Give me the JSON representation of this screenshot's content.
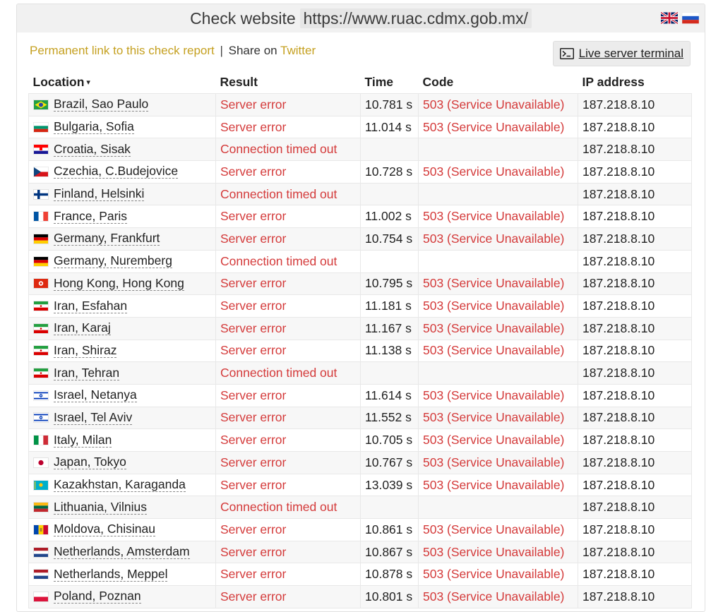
{
  "header": {
    "title_label": "Check website",
    "url": "https://www.ruac.cdmx.gob.mx/",
    "languages": [
      {
        "name": "English",
        "icon": "uk-flag-icon"
      },
      {
        "name": "Russian",
        "icon": "russia-flag-icon"
      }
    ]
  },
  "links": {
    "permanent": "Permanent link to this check report",
    "separator": "|",
    "share_prefix": "Share on",
    "twitter": "Twitter"
  },
  "terminal_button": {
    "icon": "terminal-icon",
    "label": "Live server terminal"
  },
  "table": {
    "columns": {
      "location": "Location",
      "sort_indicator": "▾",
      "result": "Result",
      "time": "Time",
      "code": "Code",
      "ip": "IP address"
    },
    "rows": [
      {
        "country": "br",
        "location": "Brazil, Sao Paulo",
        "result": "Server error",
        "time": "10.781 s",
        "code": "503 (Service Unavailable)",
        "ip": "187.218.8.10"
      },
      {
        "country": "bg",
        "location": "Bulgaria, Sofia",
        "result": "Server error",
        "time": "11.014 s",
        "code": "503 (Service Unavailable)",
        "ip": "187.218.8.10"
      },
      {
        "country": "hr",
        "location": "Croatia, Sisak",
        "result": "Connection timed out",
        "time": "",
        "code": "",
        "ip": "187.218.8.10"
      },
      {
        "country": "cz",
        "location": "Czechia, C.Budejovice",
        "result": "Server error",
        "time": "10.728 s",
        "code": "503 (Service Unavailable)",
        "ip": "187.218.8.10"
      },
      {
        "country": "fi",
        "location": "Finland, Helsinki",
        "result": "Connection timed out",
        "time": "",
        "code": "",
        "ip": "187.218.8.10"
      },
      {
        "country": "fr",
        "location": "France, Paris",
        "result": "Server error",
        "time": "11.002 s",
        "code": "503 (Service Unavailable)",
        "ip": "187.218.8.10"
      },
      {
        "country": "de",
        "location": "Germany, Frankfurt",
        "result": "Server error",
        "time": "10.754 s",
        "code": "503 (Service Unavailable)",
        "ip": "187.218.8.10"
      },
      {
        "country": "de",
        "location": "Germany, Nuremberg",
        "result": "Connection timed out",
        "time": "",
        "code": "",
        "ip": "187.218.8.10"
      },
      {
        "country": "hk",
        "location": "Hong Kong, Hong Kong",
        "result": "Server error",
        "time": "10.795 s",
        "code": "503 (Service Unavailable)",
        "ip": "187.218.8.10"
      },
      {
        "country": "ir",
        "location": "Iran, Esfahan",
        "result": "Server error",
        "time": "11.181 s",
        "code": "503 (Service Unavailable)",
        "ip": "187.218.8.10"
      },
      {
        "country": "ir",
        "location": "Iran, Karaj",
        "result": "Server error",
        "time": "11.167 s",
        "code": "503 (Service Unavailable)",
        "ip": "187.218.8.10"
      },
      {
        "country": "ir",
        "location": "Iran, Shiraz",
        "result": "Server error",
        "time": "11.138 s",
        "code": "503 (Service Unavailable)",
        "ip": "187.218.8.10"
      },
      {
        "country": "ir",
        "location": "Iran, Tehran",
        "result": "Connection timed out",
        "time": "",
        "code": "",
        "ip": "187.218.8.10"
      },
      {
        "country": "il",
        "location": "Israel, Netanya",
        "result": "Server error",
        "time": "11.614 s",
        "code": "503 (Service Unavailable)",
        "ip": "187.218.8.10"
      },
      {
        "country": "il",
        "location": "Israel, Tel Aviv",
        "result": "Server error",
        "time": "11.552 s",
        "code": "503 (Service Unavailable)",
        "ip": "187.218.8.10"
      },
      {
        "country": "it",
        "location": "Italy, Milan",
        "result": "Server error",
        "time": "10.705 s",
        "code": "503 (Service Unavailable)",
        "ip": "187.218.8.10"
      },
      {
        "country": "jp",
        "location": "Japan, Tokyo",
        "result": "Server error",
        "time": "10.767 s",
        "code": "503 (Service Unavailable)",
        "ip": "187.218.8.10"
      },
      {
        "country": "kz",
        "location": "Kazakhstan, Karaganda",
        "result": "Server error",
        "time": "13.039 s",
        "code": "503 (Service Unavailable)",
        "ip": "187.218.8.10"
      },
      {
        "country": "lt",
        "location": "Lithuania, Vilnius",
        "result": "Connection timed out",
        "time": "",
        "code": "",
        "ip": "187.218.8.10"
      },
      {
        "country": "md",
        "location": "Moldova, Chisinau",
        "result": "Server error",
        "time": "10.861 s",
        "code": "503 (Service Unavailable)",
        "ip": "187.218.8.10"
      },
      {
        "country": "nl",
        "location": "Netherlands, Amsterdam",
        "result": "Server error",
        "time": "10.867 s",
        "code": "503 (Service Unavailable)",
        "ip": "187.218.8.10"
      },
      {
        "country": "nl",
        "location": "Netherlands, Meppel",
        "result": "Server error",
        "time": "10.878 s",
        "code": "503 (Service Unavailable)",
        "ip": "187.218.8.10"
      },
      {
        "country": "pl",
        "location": "Poland, Poznan",
        "result": "Server error",
        "time": "10.801 s",
        "code": "503 (Service Unavailable)",
        "ip": "187.218.8.10"
      }
    ]
  },
  "colors": {
    "error_text": "#d43a3a",
    "link_yellow": "#c5a020",
    "title_bar_bg": "#f1f1f1"
  }
}
